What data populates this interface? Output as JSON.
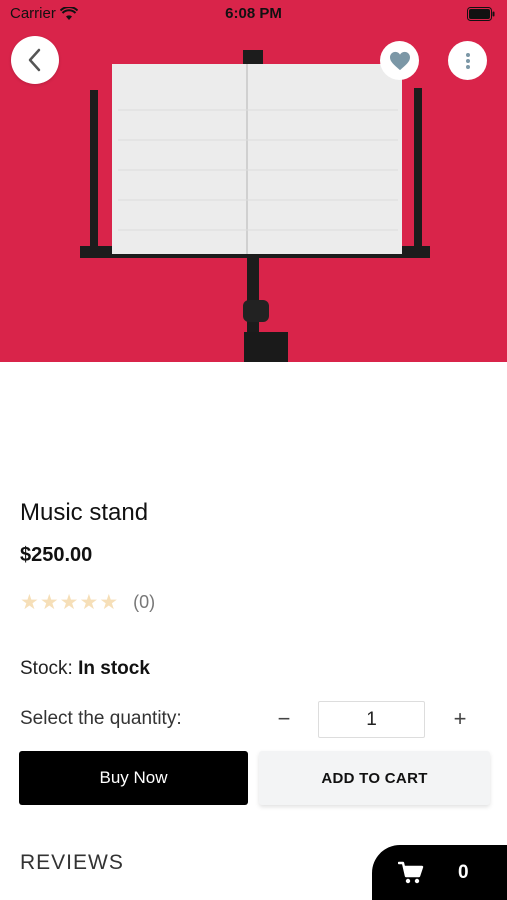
{
  "status_bar": {
    "carrier": "Carrier",
    "time": "6:08 PM",
    "wifi_icon": "wifi-icon",
    "battery_icon": "battery-icon"
  },
  "hero": {
    "background_color": "#d9244a",
    "back_icon": "chevron-left-icon",
    "favorite_icon": "heart-icon",
    "favorite_color": "#7b97a6",
    "more_icon": "more-vertical-icon"
  },
  "product": {
    "title": "Music stand",
    "price": "$250.00",
    "rating_stars": 0,
    "rating_max": 5,
    "rating_count": "(0)",
    "star_color": "#f6dfb8"
  },
  "stock": {
    "label": "Stock:",
    "value": "In stock"
  },
  "quantity": {
    "label": "Select the quantity:",
    "minus": "−",
    "value": "1",
    "plus": "+"
  },
  "actions": {
    "buy_now": "Buy Now",
    "add_to_cart": "ADD TO CART"
  },
  "reviews": {
    "heading": "REVIEWS"
  },
  "cart": {
    "icon": "cart-icon",
    "count": "0"
  }
}
